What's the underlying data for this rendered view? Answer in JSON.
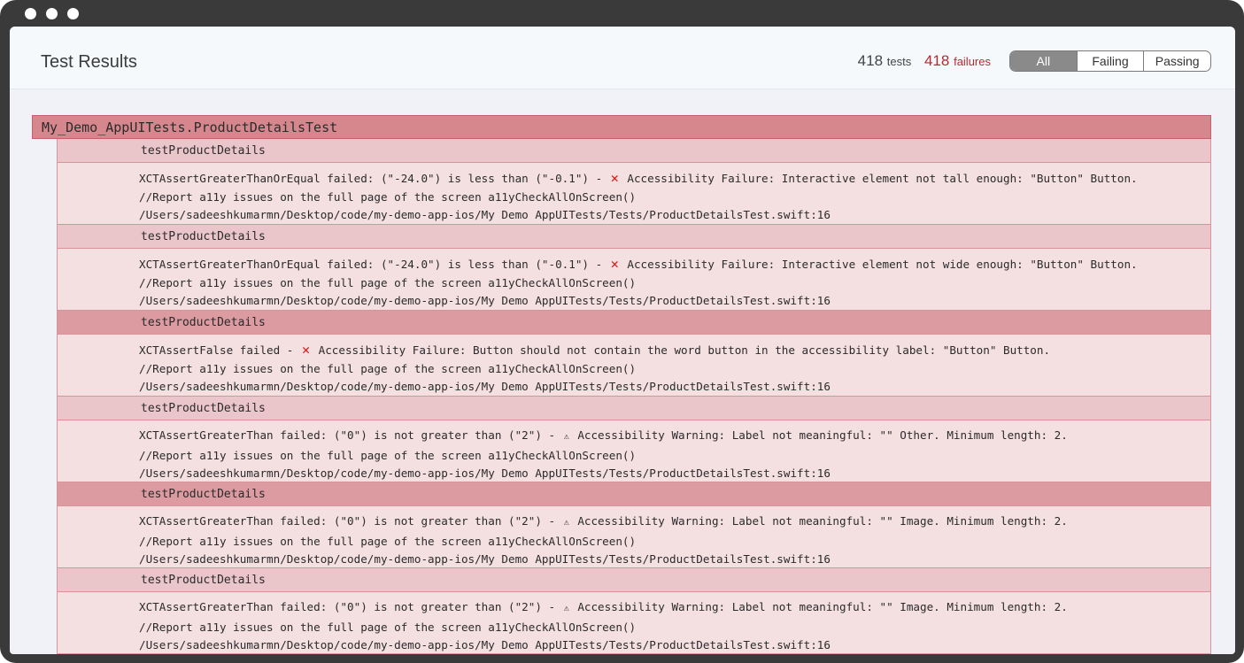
{
  "header": {
    "title": "Test Results",
    "tests_count": "418",
    "tests_label": "tests",
    "failures_count": "418",
    "failures_label": "failures",
    "filters": [
      "All",
      "Failing",
      "Passing"
    ],
    "selected_filter": "All"
  },
  "suite": {
    "name": "My_Demo_AppUITests.ProductDetailsTest"
  },
  "cases": [
    {
      "name": "testProductDetails",
      "status_icon": "x-icon",
      "message_prefix": "XCTAssertGreaterThanOrEqual failed: (\"-24.0\") is less than (\"-0.1\") -",
      "message_suffix": "Accessibility Failure: Interactive element not tall enough: \"Button\" Button.",
      "code_line": "//Report a11y issues on the full page of the screen a11yCheckAllOnScreen()",
      "location": "/Users/sadeeshkumarmn/Desktop/code/my-demo-app-ios/My Demo AppUITests/Tests/ProductDetailsTest.swift:16"
    },
    {
      "name": "testProductDetails",
      "status_icon": "x-icon",
      "message_prefix": "XCTAssertGreaterThanOrEqual failed: (\"-24.0\") is less than (\"-0.1\") -",
      "message_suffix": "Accessibility Failure: Interactive element not wide enough: \"Button\" Button.",
      "code_line": "//Report a11y issues on the full page of the screen a11yCheckAllOnScreen()",
      "location": "/Users/sadeeshkumarmn/Desktop/code/my-demo-app-ios/My Demo AppUITests/Tests/ProductDetailsTest.swift:16"
    },
    {
      "name": "testProductDetails",
      "status_icon": "x-icon",
      "message_prefix": "XCTAssertFalse failed -",
      "message_suffix": "Accessibility Failure: Button should not contain the word button in the accessibility label: \"Button\" Button.",
      "code_line": "//Report a11y issues on the full page of the screen a11yCheckAllOnScreen()",
      "location": "/Users/sadeeshkumarmn/Desktop/code/my-demo-app-ios/My Demo AppUITests/Tests/ProductDetailsTest.swift:16"
    },
    {
      "name": "testProductDetails",
      "status_icon": "warning-icon",
      "message_prefix": "XCTAssertGreaterThan failed: (\"0\") is not greater than (\"2\") -",
      "message_suffix": "Accessibility Warning: Label not meaningful: \"\" Other. Minimum length: 2.",
      "code_line": "//Report a11y issues on the full page of the screen a11yCheckAllOnScreen()",
      "location": "/Users/sadeeshkumarmn/Desktop/code/my-demo-app-ios/My Demo AppUITests/Tests/ProductDetailsTest.swift:16"
    },
    {
      "name": "testProductDetails",
      "status_icon": "warning-icon",
      "message_prefix": "XCTAssertGreaterThan failed: (\"0\") is not greater than (\"2\") -",
      "message_suffix": "Accessibility Warning: Label not meaningful: \"\" Image. Minimum length: 2.",
      "code_line": "//Report a11y issues on the full page of the screen a11yCheckAllOnScreen()",
      "location": "/Users/sadeeshkumarmn/Desktop/code/my-demo-app-ios/My Demo AppUITests/Tests/ProductDetailsTest.swift:16"
    },
    {
      "name": "testProductDetails",
      "status_icon": "warning-icon",
      "message_prefix": "XCTAssertGreaterThan failed: (\"0\") is not greater than (\"2\") -",
      "message_suffix": "Accessibility Warning: Label not meaningful: \"\" Image. Minimum length: 2.",
      "code_line": "//Report a11y issues on the full page of the screen a11yCheckAllOnScreen()",
      "location": "/Users/sadeeshkumarmn/Desktop/code/my-demo-app-ios/My Demo AppUITests/Tests/ProductDetailsTest.swift:16"
    }
  ],
  "colors": {
    "failure_red": "#b62a31",
    "suite_bg": "#d6878e",
    "case_head_light": "#eac6cb",
    "case_head_dark": "#dc9aa1",
    "case_body": "#f4dfe1",
    "x_icon": "#e01010"
  }
}
